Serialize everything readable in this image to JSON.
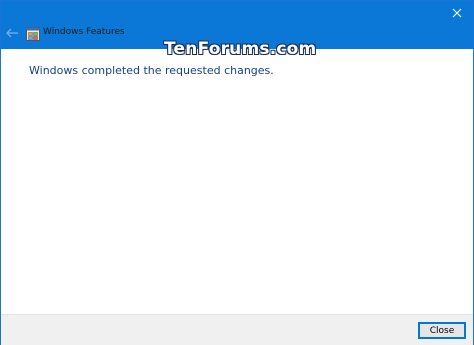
{
  "window": {
    "title": "Windows Features",
    "message": "Windows completed the requested changes.",
    "close_label": "Close",
    "watermark": "TenForums.com"
  },
  "colors": {
    "titlebar": "#0b78d7",
    "message_text": "#1a3f8f",
    "footer": "#f0f0f0",
    "accent_border": "#0078d7"
  },
  "icons": {
    "back": "back-arrow-icon",
    "app": "windows-features-icon",
    "close": "close-icon"
  }
}
